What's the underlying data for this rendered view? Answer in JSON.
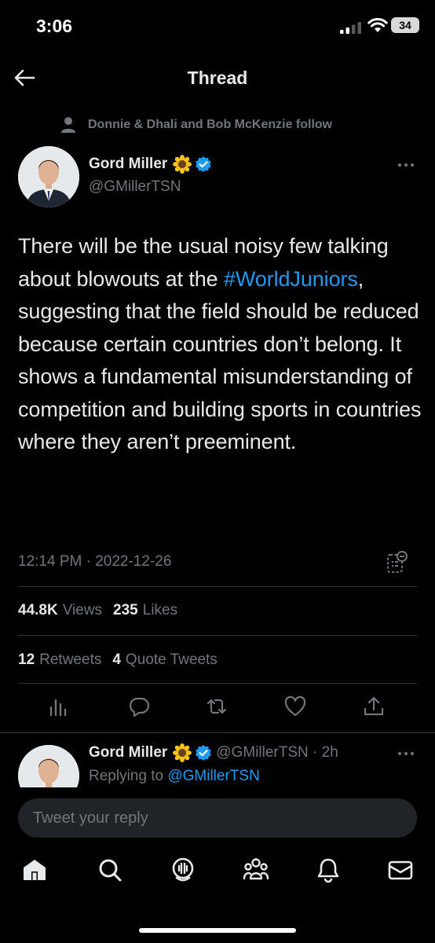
{
  "status_bar": {
    "time": "3:06",
    "battery": "34"
  },
  "header": {
    "title": "Thread",
    "back_icon": "arrow-left-icon"
  },
  "social_context": {
    "icon": "person-icon",
    "text": "Donnie & Dhali and Bob McKenzie follow"
  },
  "tweet": {
    "author_name": "Gord Miller",
    "emoji": "sunflower",
    "handle": "@GMillerTSN",
    "text_before": "There will be the usual noisy few talking about blowouts at the ",
    "hashtag": "#WorldJuniors",
    "text_after": ", suggesting that the field should be reduced because certain countries don’t belong. It shows a fundamental misunderstanding of competition and building sports in countries where they aren’t preeminent.",
    "timestamp": "12:14 PM · 2022-12-26",
    "views_count": "44.8K",
    "views_label": "Views",
    "likes_count": "235",
    "likes_label": "Likes",
    "retweets_count": "12",
    "retweets_label": "Retweets",
    "quotes_count": "4",
    "quotes_label": "Quote Tweets"
  },
  "actions": [
    "analytics-icon",
    "reply-icon",
    "retweet-icon",
    "like-icon",
    "share-icon"
  ],
  "reply": {
    "author_name": "Gord Miller",
    "handle_time": "@GMillerTSN · 2h",
    "replying_prefix": "Replying to ",
    "replying_handle": "@GMillerTSN"
  },
  "composer": {
    "placeholder": "Tweet your reply"
  },
  "tab_bar": [
    "home-icon",
    "search-icon",
    "spaces-icon",
    "communities-icon",
    "notifications-icon",
    "messages-icon"
  ],
  "colors": {
    "background": "#000000",
    "text": "#e7e9ea",
    "secondary": "#71767b",
    "accent": "#1d9bf0",
    "divider": "#2f3336"
  }
}
